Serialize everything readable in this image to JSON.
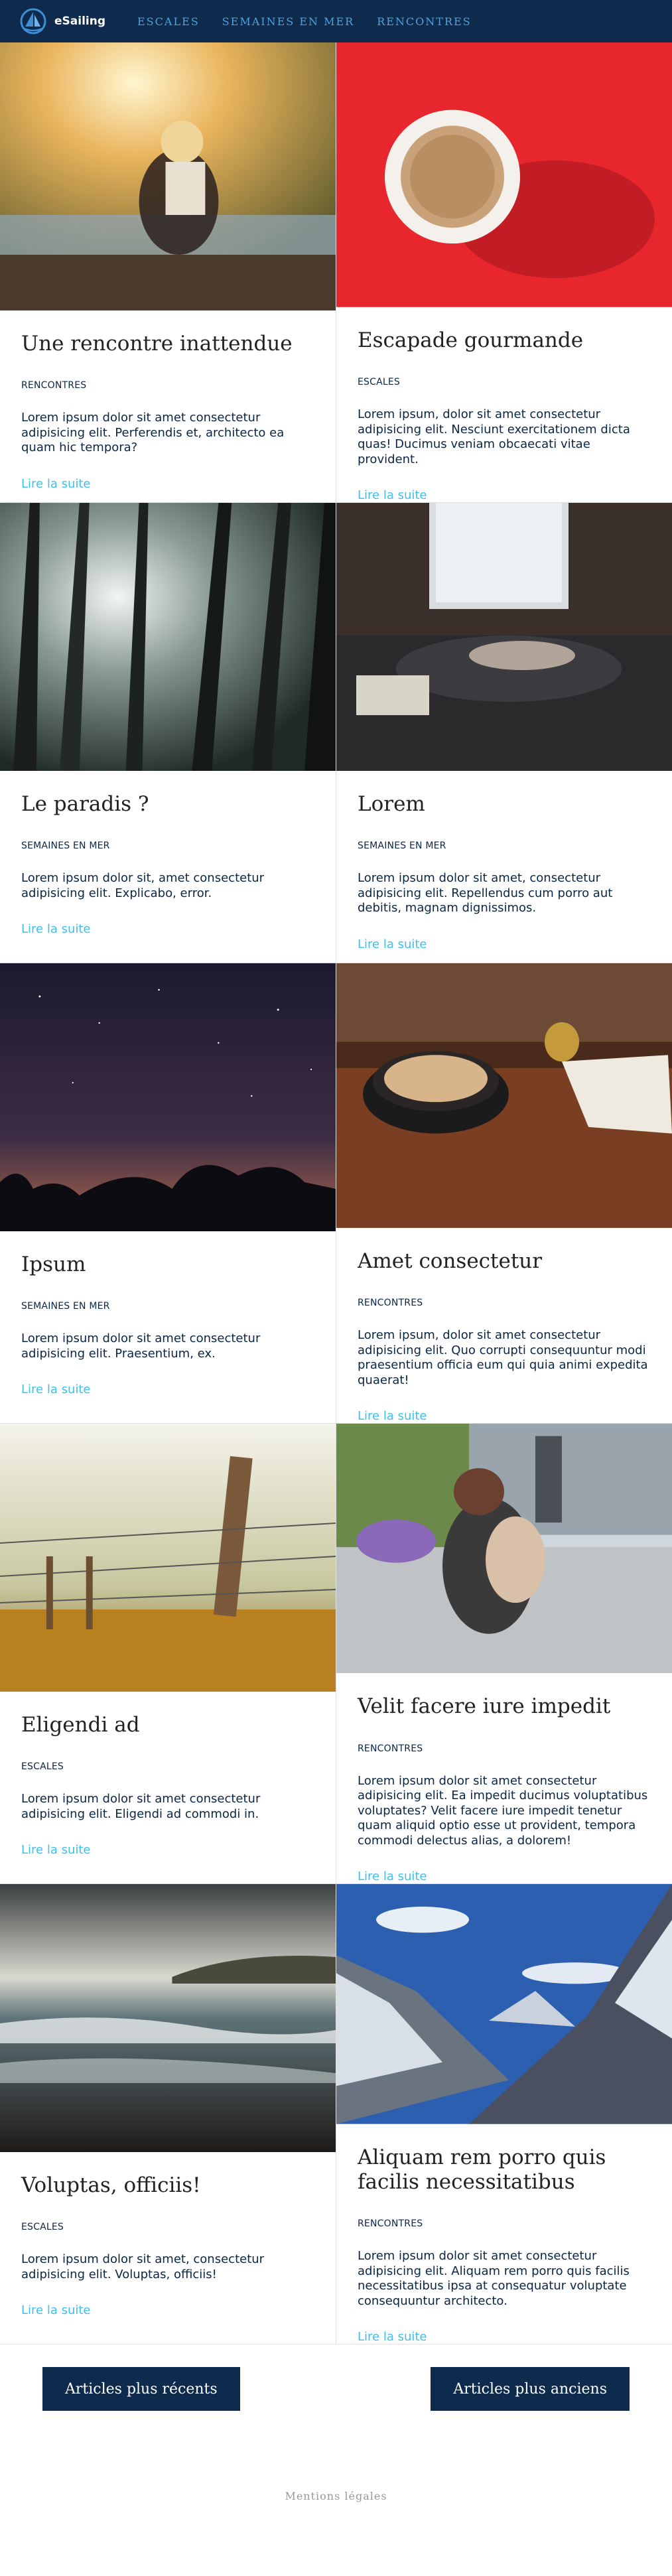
{
  "header": {
    "brand": "eSailing",
    "nav": [
      "ESCALES",
      "SEMAINES EN MER",
      "RENCONTRES"
    ]
  },
  "articles": [
    {
      "title": "Une rencontre inattendue",
      "category": "RENCONTRES",
      "excerpt": "Lorem ipsum dolor sit amet consectetur adipisicing elit. Perferendis et, architecto ea quam hic tempora?",
      "more": "Lire la suite",
      "image": "woman-lake-sunset-photo"
    },
    {
      "title": "Escapade gourmande",
      "category": "ESCALES",
      "excerpt": "Lorem ipsum, dolor sit amet consectetur adipisicing elit. Nesciunt exercitationem dicta quas! Ducimus veniam obcaecati vitae provident.",
      "more": "Lire la suite",
      "image": "coffee-cup-red-photo"
    },
    {
      "title": "Le paradis ?",
      "category": "SEMAINES EN MER",
      "excerpt": "Lorem ipsum dolor sit, amet consectetur adipisicing elit. Explicabo, error.",
      "more": "Lire la suite",
      "image": "forest-sunlight-photo"
    },
    {
      "title": "Lorem",
      "category": "SEMAINES EN MER",
      "excerpt": "Lorem ipsum dolor sit amet, consectetur adipisicing elit. Repellendus cum porro aut debitis, magnam dignissimos.",
      "more": "Lire la suite",
      "image": "sofa-window-photo"
    },
    {
      "title": "Ipsum",
      "category": "SEMAINES EN MER",
      "excerpt": "Lorem ipsum dolor sit amet consectetur adipisicing elit. Praesentium, ex.",
      "more": "Lire la suite",
      "image": "starry-night-trees-photo"
    },
    {
      "title": "Amet consectetur",
      "category": "RENCONTRES",
      "excerpt": "Lorem ipsum, dolor sit amet consectetur adipisicing elit. Quo corrupti consequuntur modi praesentium officia eum qui quia animi expedita quaerat!",
      "more": "Lire la suite",
      "image": "latte-bell-table-photo"
    },
    {
      "title": "Eligendi ad",
      "category": "ESCALES",
      "excerpt": "Lorem ipsum dolor sit amet consectetur adipisicing elit. Eligendi ad commodi in.",
      "more": "Lire la suite",
      "image": "fence-grass-photo"
    },
    {
      "title": "Velit facere iure impedit",
      "category": "RENCONTRES",
      "excerpt": "Lorem ipsum dolor sit amet consectetur adipisicing elit. Ea impedit ducimus voluptatibus voluptates? Velit facere iure impedit tenetur quam aliquid optio esse ut provident, tempora commodi delectus alias, a dolorem!",
      "more": "Lire la suite",
      "image": "mother-child-street-photo"
    },
    {
      "title": "Voluptas, officiis!",
      "category": "ESCALES",
      "excerpt": "Lorem ipsum dolor sit amet, consectetur adipisicing elit. Voluptas, officiis!",
      "more": "Lire la suite",
      "image": "beach-waves-photo"
    },
    {
      "title": "Aliquam rem porro quis facilis necessitatibus",
      "category": "RENCONTRES",
      "excerpt": "Lorem ipsum dolor sit amet consectetur adipisicing elit. Aliquam rem porro quis facilis necessitatibus ipsa at consequatur voluptate consequuntur architecto.",
      "more": "Lire la suite",
      "image": "snowy-mountains-photo"
    }
  ],
  "pager": {
    "newer": "Articles plus récents",
    "older": "Articles plus anciens"
  },
  "footer": {
    "legal": "Mentions légales"
  },
  "colors": {
    "header_bg": "#0e2a4d",
    "nav": "#4ea3d9",
    "link": "#3cc0f0",
    "button_bg": "#0e2a4d"
  }
}
